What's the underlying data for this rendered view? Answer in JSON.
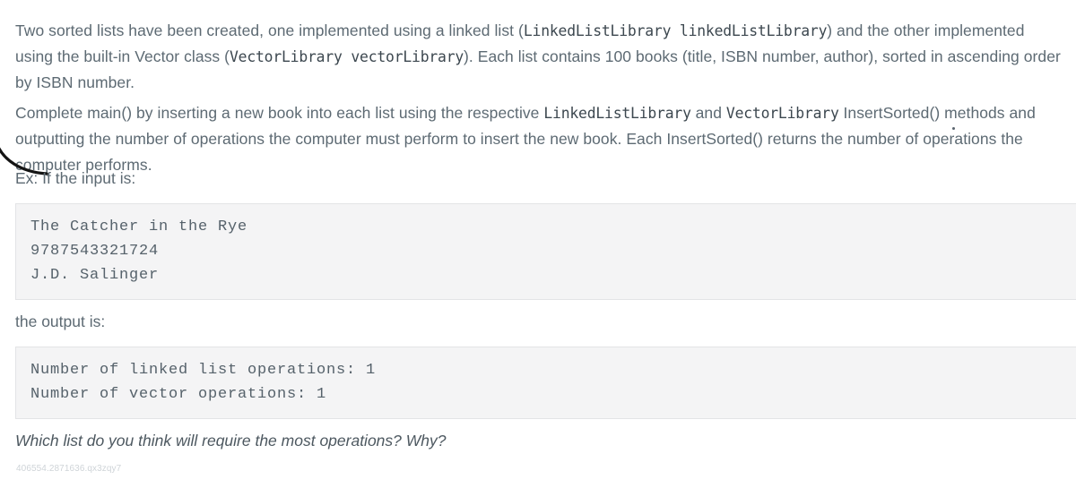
{
  "document": {
    "paragraph_1": {
      "seg_1": "Two sorted lists have been created, one implemented using a linked list (",
      "code_1": "LinkedListLibrary linkedListLibrary",
      "seg_2": ") and the other implemented using the built-in Vector class (",
      "code_2": "VectorLibrary vectorLibrary",
      "seg_3": "). Each list contains 100 books (title, ISBN number, author), sorted in ascending order by ISBN number."
    },
    "paragraph_2": {
      "seg_1": "Complete main() by inserting a new book into each list using the respective ",
      "code_1": "LinkedListLibrary",
      "seg_2": " and ",
      "code_2": "VectorLibrary",
      "seg_3": " InsertSorted() methods and outputting the number of operations the computer must perform to insert the new book. Each InsertSorted() returns the number of operations the computer performs."
    },
    "example_input_label": "Ex: If the input is:",
    "input_block": {
      "lines": [
        "The Catcher in the Rye",
        "9787543321724",
        "J.D. Salinger"
      ]
    },
    "output_label": "the output is:",
    "output_block": {
      "lines": [
        "Number of linked list operations: 1",
        "Number of vector operations: 1"
      ]
    },
    "question": "Which list do you think will require the most operations? Why?",
    "footer_id": "406554.2871636.qx3zqy7"
  },
  "colors": {
    "body_text": "#5d6a73",
    "code_text": "#3c474f",
    "code_block_bg": "#f4f4f5",
    "code_block_border": "#e3e4e6",
    "footer_id": "#cfd4d8",
    "annotation": "#1a1a1a"
  }
}
